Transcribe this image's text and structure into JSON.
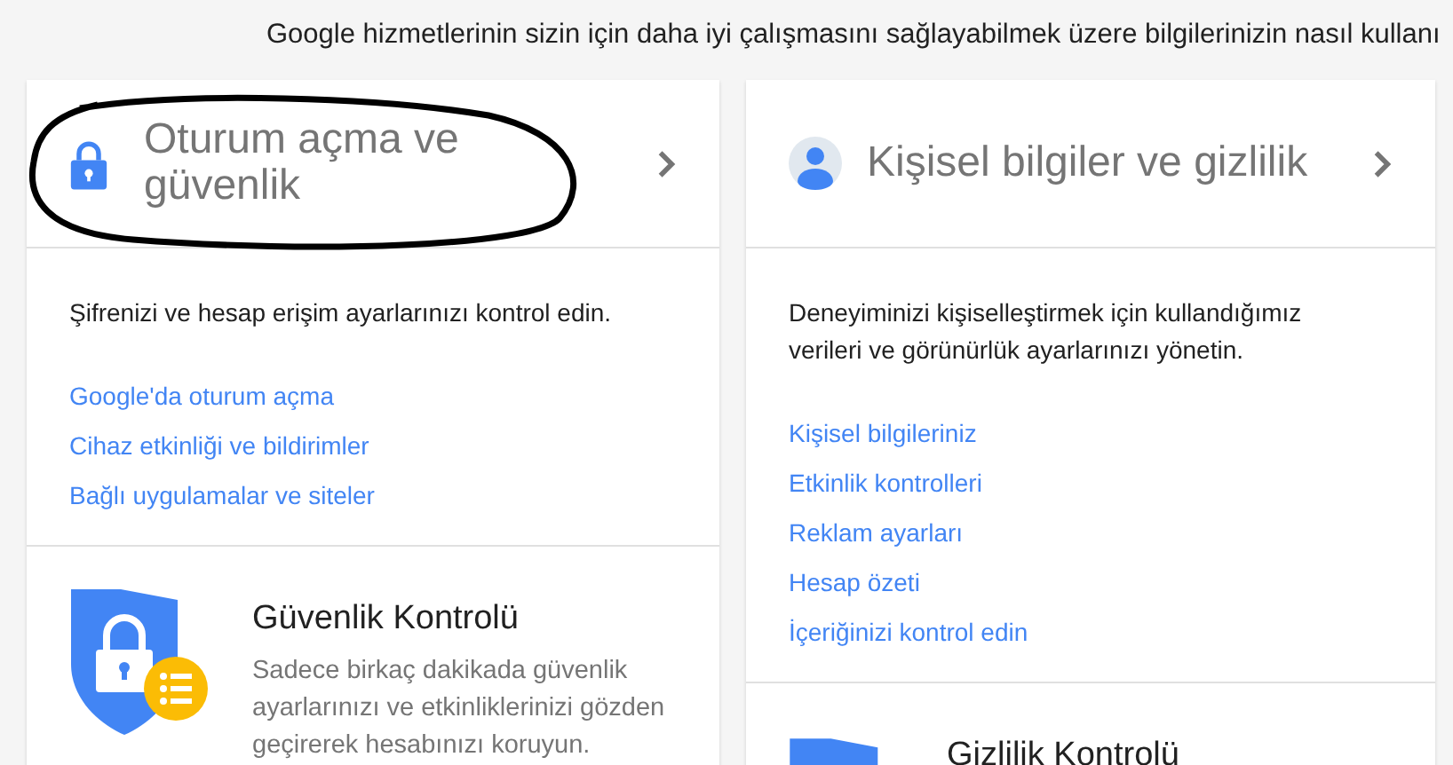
{
  "intro": [
    "Google hizmetlerinin sizin için daha iyi çalışmasını sağlayabilmek üzere bilgilerinizin nasıl kullanı"
  ],
  "cards": [
    {
      "kind": "security",
      "title": "Oturum açma ve güvenlik",
      "description": "Şifrenizi ve hesap erişim ayarlarınızı kontrol edin.",
      "links": [
        "Google'da oturum açma",
        "Cihaz etkinliği ve bildirimler",
        "Bağlı uygulamalar ve siteler"
      ],
      "checkup": {
        "title": "Güvenlik Kontrolü",
        "description": "Sadece birkaç dakikada güvenlik ayarlarınızı ve etkinliklerinizi gözden geçirerek hesabınızı koruyun."
      }
    },
    {
      "kind": "privacy",
      "title": "Kişisel bilgiler ve gizlilik",
      "description": "Deneyiminizi kişiselleştirmek için kullandığımız verileri ve görünürlük ayarlarınızı yönetin.",
      "links": [
        "Kişisel bilgileriniz",
        "Etkinlik kontrolleri",
        "Reklam ayarları",
        "Hesap özeti",
        "İçeriğinizi kontrol edin"
      ],
      "checkup": {
        "title": "Gizlilik Kontrolü"
      }
    }
  ]
}
